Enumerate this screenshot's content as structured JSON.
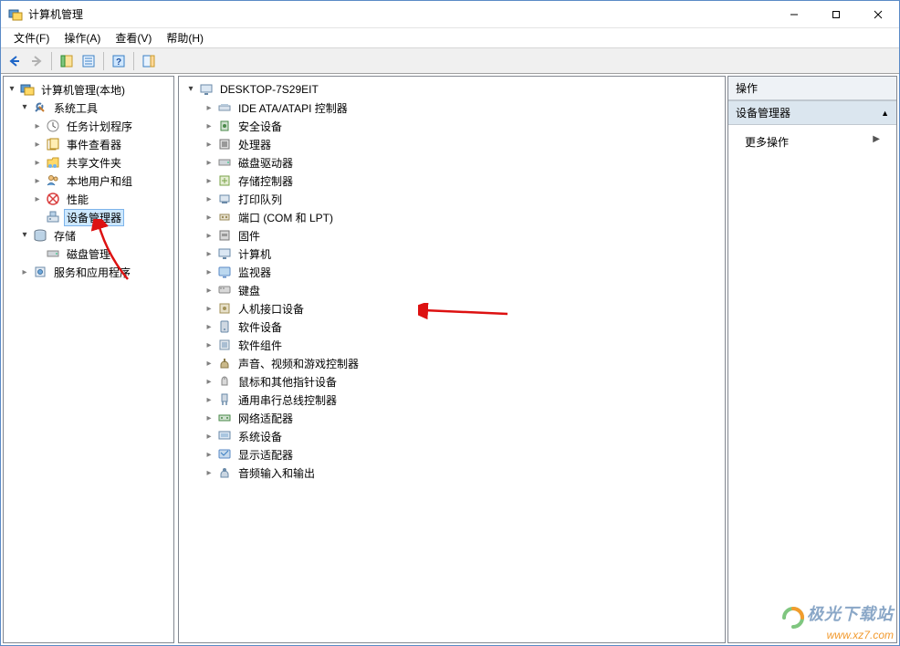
{
  "window": {
    "title": "计算机管理"
  },
  "menu": {
    "file": "文件(F)",
    "action": "操作(A)",
    "view": "查看(V)",
    "help": "帮助(H)"
  },
  "left_tree": {
    "root": "计算机管理(本地)",
    "system_tools": "系统工具",
    "task_scheduler": "任务计划程序",
    "event_viewer": "事件查看器",
    "shared_folders": "共享文件夹",
    "local_users": "本地用户和组",
    "performance": "性能",
    "device_manager": "设备管理器",
    "storage": "存储",
    "disk_management": "磁盘管理",
    "services_apps": "服务和应用程序"
  },
  "center_tree": {
    "root": "DESKTOP-7S29EIT",
    "items": [
      "IDE ATA/ATAPI 控制器",
      "安全设备",
      "处理器",
      "磁盘驱动器",
      "存储控制器",
      "打印队列",
      "端口 (COM 和 LPT)",
      "固件",
      "计算机",
      "监视器",
      "键盘",
      "人机接口设备",
      "软件设备",
      "软件组件",
      "声音、视频和游戏控制器",
      "鼠标和其他指针设备",
      "通用串行总线控制器",
      "网络适配器",
      "系统设备",
      "显示适配器",
      "音频输入和输出"
    ]
  },
  "actions_panel": {
    "header": "操作",
    "group": "设备管理器",
    "more": "更多操作"
  },
  "watermark": {
    "brand": "极光下载站",
    "url": "www.xz7.com"
  }
}
